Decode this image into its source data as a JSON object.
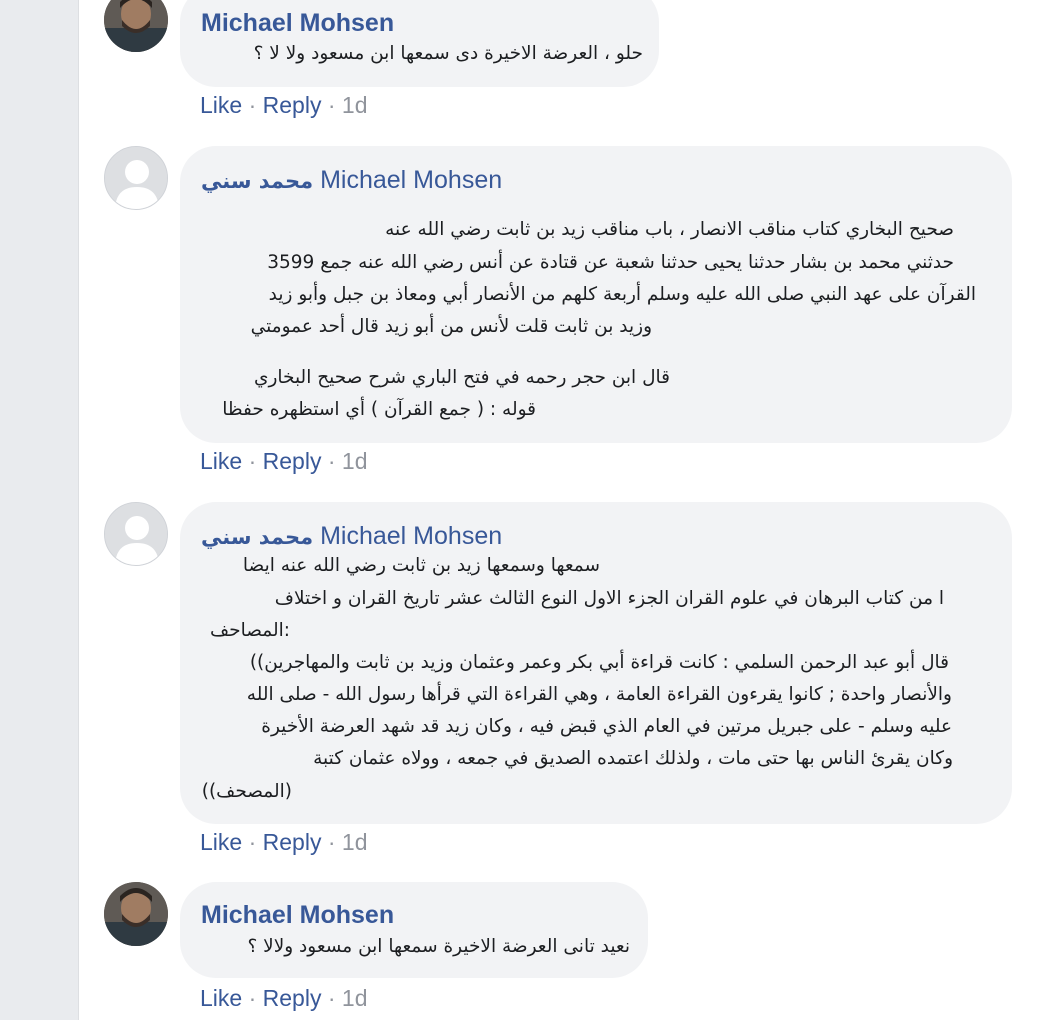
{
  "comments": [
    {
      "author": "Michael Mohsen",
      "author_ar": "",
      "lines": [
        "حلو ، العرضة الاخيرة دى سمعها ابن مسعود ولا لا ؟"
      ],
      "like": "Like",
      "reply": "Reply",
      "sep": "·",
      "time": "1d"
    },
    {
      "author": "Michael Mohsen",
      "author_ar": "محمد سني",
      "lines": [
        "صحيح البخاري كتاب مناقب الانصار ، باب مناقب زيد بن ثابت رضي الله عنه",
        "حدثني محمد بن بشار حدثنا يحيى حدثنا شعبة عن قتادة عن أنس رضي الله عنه جمع 3599",
        "القرآن على عهد النبي صلى الله عليه وسلم أربعة كلهم من الأنصار أبي ومعاذ بن جبل وأبو زيد",
        "وزيد بن ثابت قلت لأنس من أبو زيد قال أحد عمومتي",
        "قال ابن حجر رحمه في فتح الباري شرح صحيح البخاري",
        "قوله : ( جمع القرآن ) أي استظهره حفظا"
      ],
      "like": "Like",
      "reply": "Reply",
      "sep": "·",
      "time": "1d"
    },
    {
      "author": "Michael Mohsen",
      "author_ar": "محمد سني",
      "lines": [
        "سمعها وسمعها زيد بن ثابت رضي الله عنه ايضا",
        "ا من كتاب البرهان في علوم القران الجزء الاول النوع الثالث عشر تاريخ القران و اختلاف",
        ":المصاحف",
        "قال أبو عبد الرحمن السلمي : كانت قراءة أبي بكر وعمر وعثمان وزيد بن ثابت والمهاجرين))",
        "والأنصار واحدة ; كانوا يقرءون القراءة العامة ، وهي القراءة التي قرأها رسول الله - صلى الله",
        "عليه وسلم - على جبريل مرتين في العام الذي قبض فيه ، وكان زيد قد شهد العرضة الأخيرة",
        "وكان يقرئ الناس بها حتى مات ، ولذلك اعتمده الصديق في جمعه ، وولاه عثمان كتبة",
        "(المصحف))"
      ],
      "like": "Like",
      "reply": "Reply",
      "sep": "·",
      "time": "1d"
    },
    {
      "author": "Michael Mohsen",
      "author_ar": "",
      "lines": [
        "نعيد تانى العرضة الاخيرة سمعها ابن مسعود ولالا ؟"
      ],
      "like": "Like",
      "reply": "Reply",
      "sep": "·",
      "time": "1d"
    }
  ]
}
